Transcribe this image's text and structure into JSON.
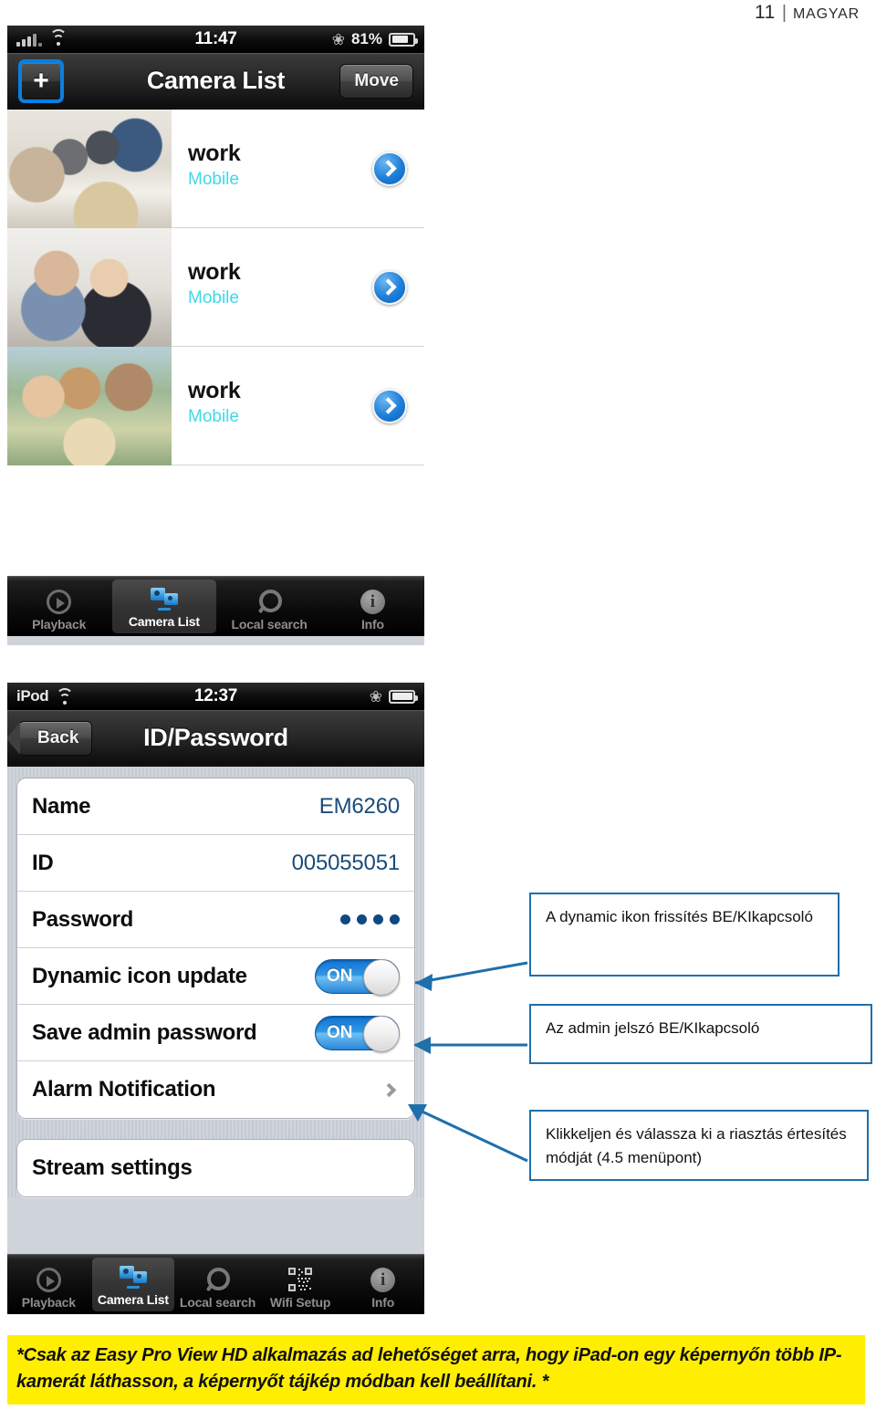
{
  "page_header": {
    "page_number": "11",
    "separator": "|",
    "language": "MAGYAR"
  },
  "screenshot_camera_list": {
    "status_bar": {
      "carrier": "",
      "signal_icon": "signal-bars-icon",
      "wifi_icon": "wifi-icon",
      "time": "11:47",
      "bluetooth_icon": "bluetooth-icon",
      "battery_percent": "81%",
      "battery_icon": "battery-icon"
    },
    "nav": {
      "add_button_label": "+",
      "title": "Camera List",
      "move_button_label": "Move"
    },
    "cameras": [
      {
        "name": "work",
        "connection": "Mobile",
        "thumb": "office-meeting-photo",
        "disclosure": "disclosure-arrow-icon"
      },
      {
        "name": "work",
        "connection": "Mobile",
        "thumb": "two-colleagues-laptop-photo",
        "disclosure": "disclosure-arrow-icon"
      },
      {
        "name": "work",
        "connection": "Mobile",
        "thumb": "family-outdoor-photo",
        "disclosure": "disclosure-arrow-icon"
      }
    ],
    "tabs": [
      {
        "label": "Playback",
        "icon": "playback-icon",
        "active": false
      },
      {
        "label": "Camera List",
        "icon": "camera-list-icon",
        "active": true
      },
      {
        "label": "Local search",
        "icon": "search-icon",
        "active": false
      },
      {
        "label": "Info",
        "icon": "info-icon",
        "active": false
      }
    ]
  },
  "screenshot_id_password": {
    "status_bar": {
      "carrier": "iPod",
      "wifi_icon": "wifi-icon",
      "time": "12:37",
      "bluetooth_icon": "bluetooth-icon",
      "battery_icon": "battery-icon"
    },
    "nav": {
      "back_button_label": "Back",
      "title": "ID/Password"
    },
    "group_one": [
      {
        "label": "Name",
        "type": "value",
        "value": "EM6260"
      },
      {
        "label": "ID",
        "type": "value",
        "value": "005055051"
      },
      {
        "label": "Password",
        "type": "dots",
        "dots": 4
      },
      {
        "label": "Dynamic icon update",
        "type": "toggle",
        "value": "ON"
      },
      {
        "label": "Save admin password",
        "type": "toggle",
        "value": "ON"
      },
      {
        "label": "Alarm Notification",
        "type": "chevron",
        "icon": "chevron-right-icon"
      }
    ],
    "group_two": [
      {
        "label": "Stream settings",
        "type": "plain"
      }
    ],
    "tabs": [
      {
        "label": "Playback",
        "icon": "playback-icon",
        "active": false
      },
      {
        "label": "Camera List",
        "icon": "camera-list-icon",
        "active": true
      },
      {
        "label": "Local search",
        "icon": "search-icon",
        "active": false
      },
      {
        "label": "Wifi Setup",
        "icon": "qr-code-icon",
        "active": false
      },
      {
        "label": "Info",
        "icon": "info-icon",
        "active": false
      }
    ]
  },
  "callouts": {
    "dynamic_icon": "A dynamic ikon frissítés BE/KIkapcsoló",
    "save_admin": "Az admin jelszó BE/KIkapcsoló",
    "alarm_notification": "Klikkeljen és válassza ki a riasztás értesítés módját (4.5 menüpont)"
  },
  "footnote": {
    "text": "*Csak az Easy Pro View HD alkalmazás ad lehetőséget arra, hogy iPad-on  egy képernyőn több IP-kamerát láthasson, a képernyőt  tájkép módban kell beállítani. *"
  },
  "colors": {
    "accent_blue": "#1f6fab",
    "link_blue": "#1b4b7a",
    "cyan_sub": "#3fd8e8",
    "toggle_on": "#2f97e8",
    "highlight_yellow": "#ffee00",
    "selection_blue": "#0b7fe0"
  }
}
